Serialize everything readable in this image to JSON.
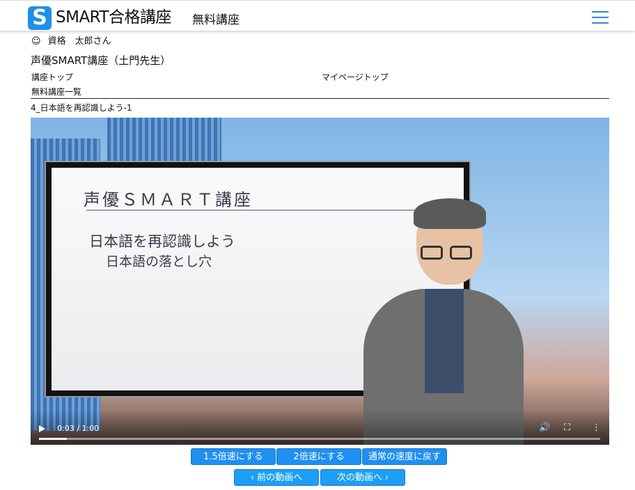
{
  "header": {
    "logo_letter": "S",
    "brand": "SMART合格講座",
    "subtitle": "無料講座"
  },
  "user": {
    "icon": "smile-icon",
    "glyph": "☺",
    "name": "資格　太郎さん"
  },
  "course_title": "声優SMART講座（土門先生）",
  "nav": {
    "course_top": "講座トップ",
    "mypage_top": "マイページトップ",
    "free_list": "無料講座一覧"
  },
  "lesson_title": "4_日本語を再認識しよう-1",
  "video": {
    "slide_title": "声優ＳＭＡＲＴ講座",
    "slide_line1": "日本語を再認識しよう",
    "slide_line2": "日本語の落とし穴",
    "time": "0:03 / 1:00",
    "progress": 0.05
  },
  "buttons": {
    "speed_15": "1.5倍速にする",
    "speed_2": "2倍速にする",
    "speed_reset": "通常の速度に戻す",
    "prev": "前の動画へ",
    "next": "次の動画へ"
  },
  "icons": {
    "menu": "hamburger-icon",
    "play": "play-icon",
    "volume": "volume-icon",
    "fullscreen": "fullscreen-icon",
    "more": "more-vertical-icon",
    "prev": "chevron-left-icon",
    "next": "chevron-right-icon"
  },
  "colors": {
    "accent": "#1f8ff0",
    "logo": "#1e90e8"
  }
}
